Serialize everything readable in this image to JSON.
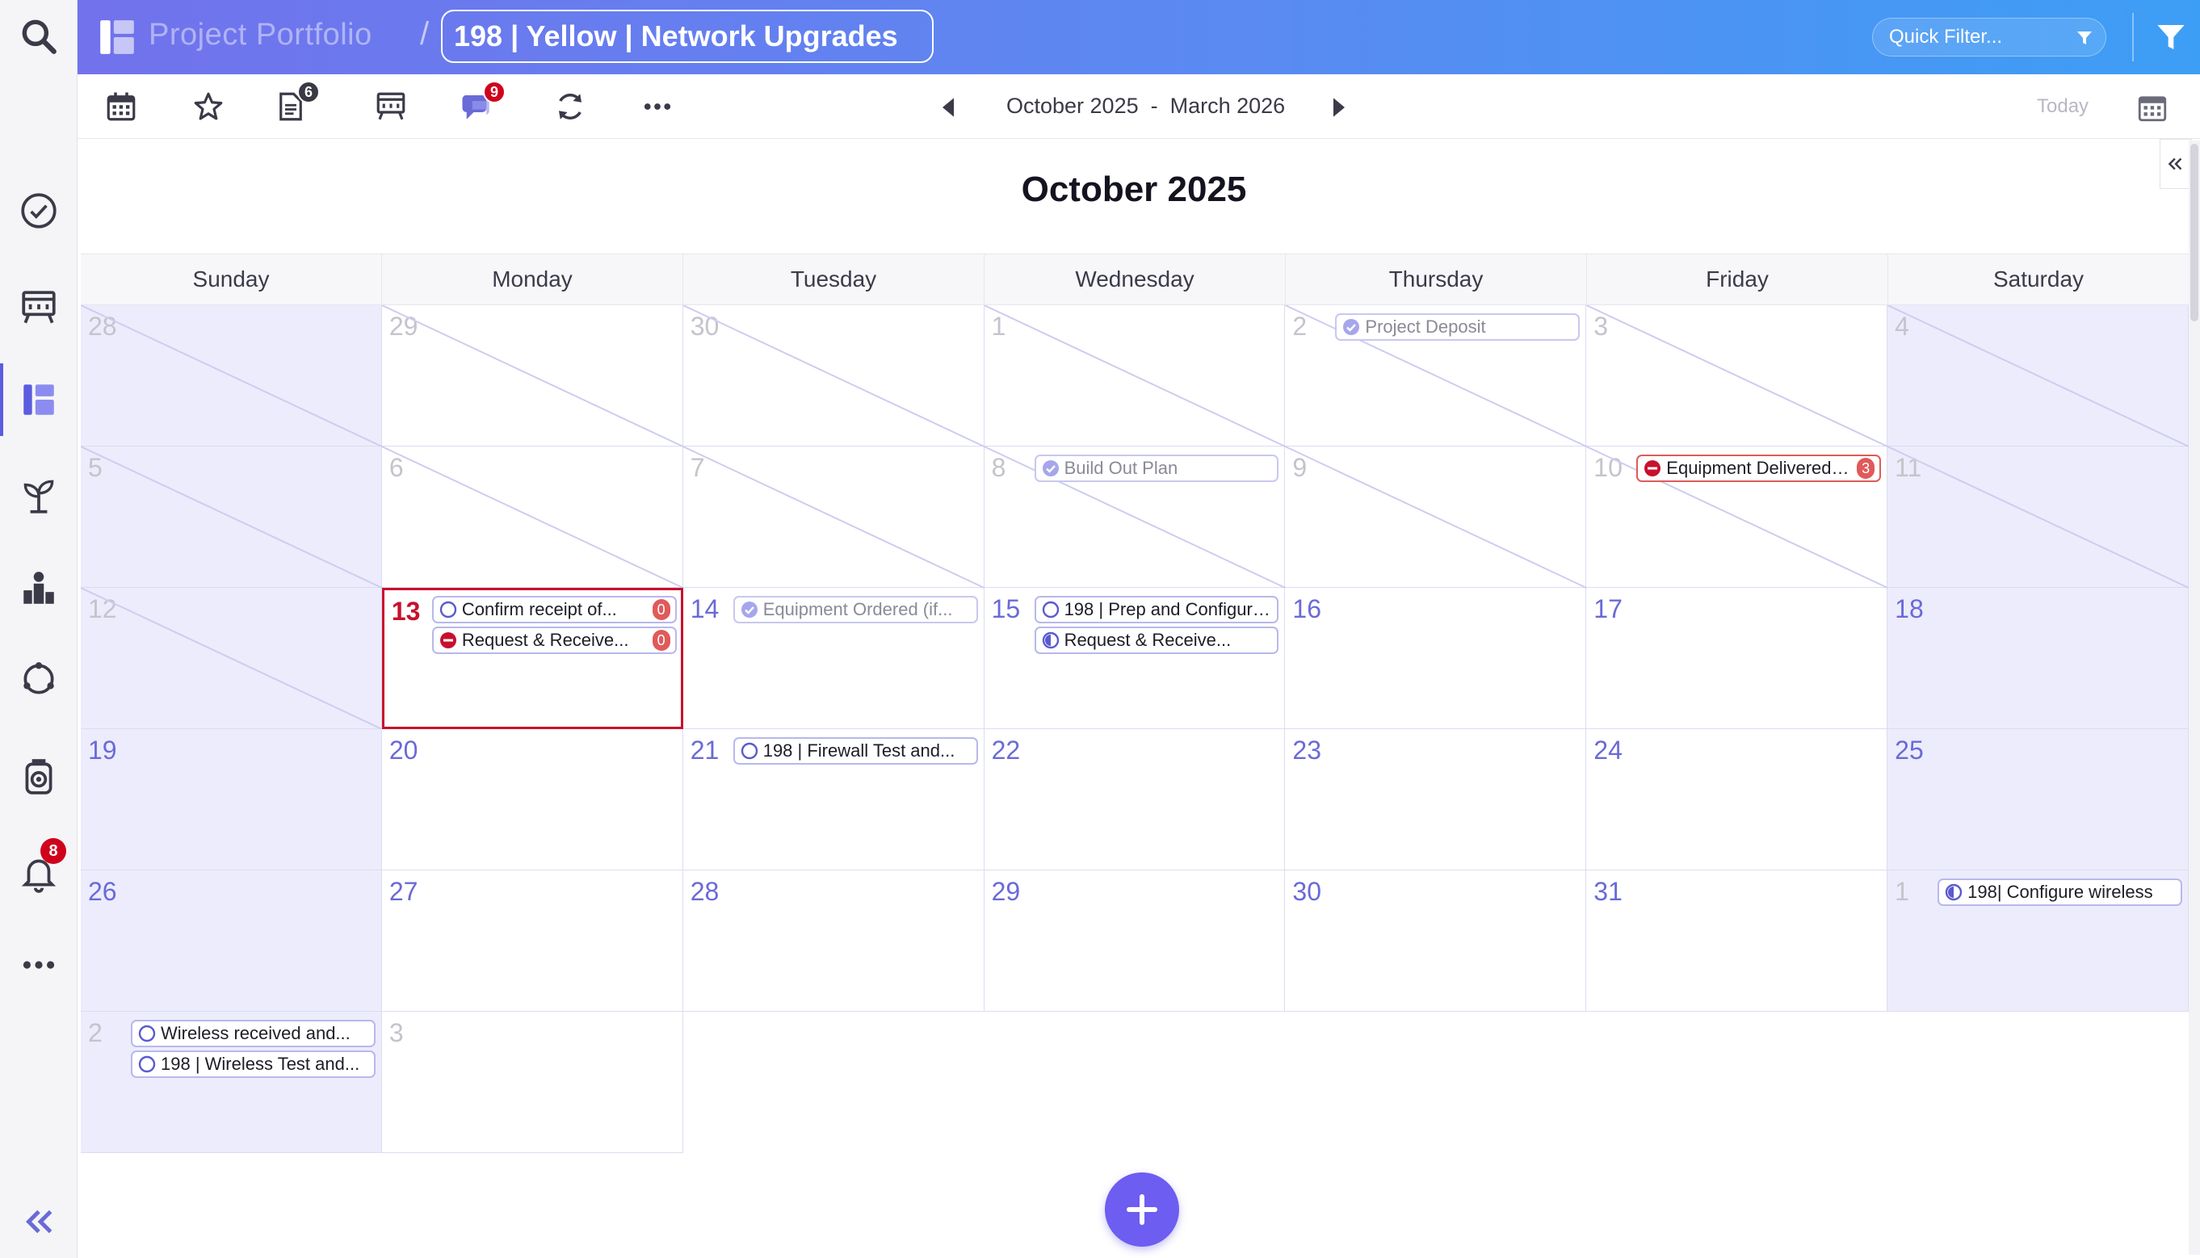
{
  "app": {
    "portfolio_label": "Project Portfolio",
    "separator": "/",
    "project_title": "198 | Yellow | Network Upgrades",
    "quick_filter_label": "Quick Filter...",
    "brand_color": "#6c6ce8",
    "accent_red": "#c8102e"
  },
  "sidebar": {
    "items": [
      {
        "name": "search-icon"
      },
      {
        "name": "check-circle-icon"
      },
      {
        "name": "board-icon"
      },
      {
        "name": "portfolio-icon",
        "active": true
      },
      {
        "name": "sprout-icon"
      },
      {
        "name": "people-chart-icon"
      },
      {
        "name": "cycle-icon"
      },
      {
        "name": "camera-jar-icon"
      },
      {
        "name": "bell-icon",
        "badge": "8"
      },
      {
        "name": "more-icon"
      }
    ],
    "collapse_icon": "double-chevron-left-icon"
  },
  "toolbar": {
    "documents_badge": "6",
    "messages_badge": "9",
    "range_label": "October 2025  -  March 2026",
    "today_label": "Today",
    "icons": [
      "calendar-icon",
      "star-icon",
      "documents-icon",
      "board-icon",
      "messages-icon",
      "refresh-icon",
      "more-icon"
    ]
  },
  "calendar": {
    "month_title": "October 2025",
    "weekdays": [
      "Sunday",
      "Monday",
      "Tuesday",
      "Wednesday",
      "Thursday",
      "Friday",
      "Saturday"
    ],
    "weeks": [
      [
        {
          "d": "28",
          "muted": true
        },
        {
          "d": "29",
          "muted": true
        },
        {
          "d": "30",
          "muted": true
        },
        {
          "d": "1",
          "muted": true
        },
        {
          "d": "2",
          "muted": true
        },
        {
          "d": "3",
          "muted": true
        },
        {
          "d": "4",
          "muted": true
        }
      ],
      [
        {
          "d": "5",
          "muted": true
        },
        {
          "d": "6",
          "muted": true
        },
        {
          "d": "7",
          "muted": true
        },
        {
          "d": "8",
          "muted": true
        },
        {
          "d": "9",
          "muted": true
        },
        {
          "d": "10",
          "muted": true
        },
        {
          "d": "11",
          "muted": true
        }
      ],
      [
        {
          "d": "12",
          "muted": true
        },
        {
          "d": "13",
          "today": true
        },
        {
          "d": "14"
        },
        {
          "d": "15"
        },
        {
          "d": "16"
        },
        {
          "d": "17"
        },
        {
          "d": "18"
        }
      ],
      [
        {
          "d": "19"
        },
        {
          "d": "20"
        },
        {
          "d": "21"
        },
        {
          "d": "22"
        },
        {
          "d": "23"
        },
        {
          "d": "24"
        },
        {
          "d": "25"
        }
      ],
      [
        {
          "d": "26"
        },
        {
          "d": "27"
        },
        {
          "d": "28"
        },
        {
          "d": "29"
        },
        {
          "d": "30"
        },
        {
          "d": "31"
        },
        {
          "d": "1",
          "muted": true
        }
      ],
      [
        {
          "d": "2",
          "muted": true
        },
        {
          "d": "3",
          "muted": true
        }
      ]
    ],
    "events": [
      {
        "week": 0,
        "day": 4,
        "slot": 0,
        "label": "Project Deposit",
        "status": "done",
        "faded": true
      },
      {
        "week": 1,
        "day": 3,
        "slot": 0,
        "label": "Build Out Plan",
        "status": "done",
        "faded": true
      },
      {
        "week": 1,
        "day": 5,
        "slot": 0,
        "label": "Equipment Delivered /...",
        "status": "blocked",
        "count": "3",
        "alert": true
      },
      {
        "week": 2,
        "day": 1,
        "slot": 0,
        "label": "Confirm receipt of...",
        "status": "open",
        "count": "0"
      },
      {
        "week": 2,
        "day": 1,
        "slot": 1,
        "label": "Request & Receive...",
        "status": "blocked",
        "count": "0"
      },
      {
        "week": 2,
        "day": 2,
        "slot": 0,
        "label": "Equipment Ordered (if...",
        "status": "done",
        "faded": true
      },
      {
        "week": 2,
        "day": 3,
        "slot": 0,
        "label": "198 | Prep and Configure...",
        "status": "open"
      },
      {
        "week": 2,
        "day": 3,
        "slot": 1,
        "label": "Request & Receive...",
        "status": "half"
      },
      {
        "week": 3,
        "day": 2,
        "slot": 0,
        "label": "198 | Firewall Test and...",
        "status": "open"
      },
      {
        "week": 4,
        "day": 6,
        "slot": 0,
        "label": "198| Configure wireless",
        "status": "half"
      },
      {
        "week": 5,
        "day": 0,
        "slot": 0,
        "label": "Wireless received and...",
        "status": "open"
      },
      {
        "week": 5,
        "day": 0,
        "slot": 1,
        "label": "198 | Wireless Test and...",
        "status": "open"
      }
    ]
  }
}
